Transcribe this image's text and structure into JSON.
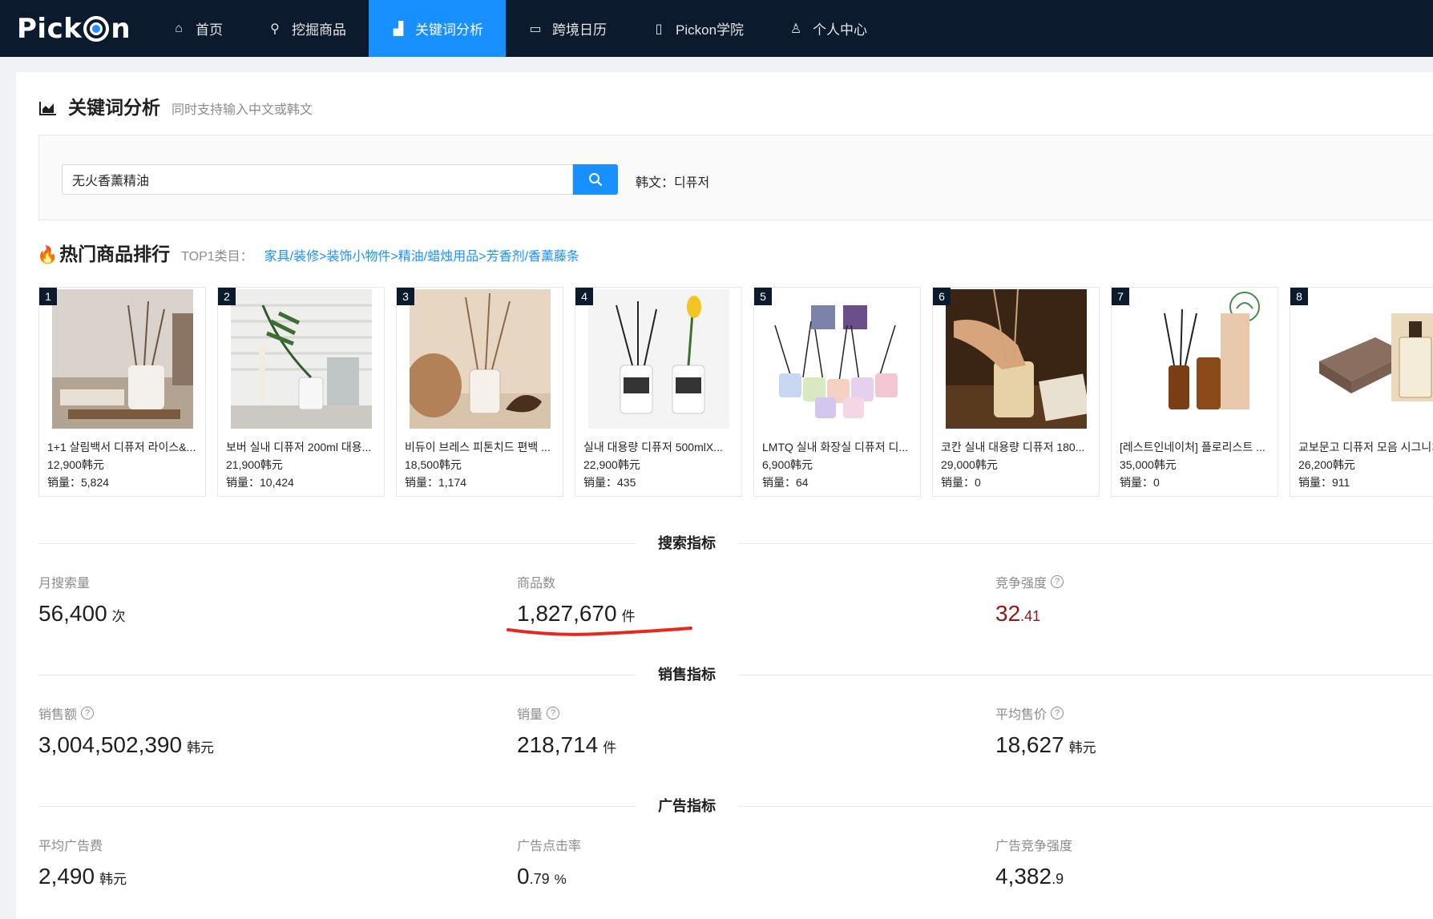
{
  "nav": {
    "logo": "Pick On",
    "items": [
      {
        "label": "首页",
        "icon": "home-icon",
        "glyph": "⌂"
      },
      {
        "label": "挖掘商品",
        "icon": "search-icon",
        "glyph": "⚲"
      },
      {
        "label": "关键词分析",
        "icon": "chart-icon",
        "glyph": "▟",
        "active": true
      },
      {
        "label": "跨境日历",
        "icon": "calendar-icon",
        "glyph": "▭"
      },
      {
        "label": "Pickon学院",
        "icon": "book-icon",
        "glyph": "▯"
      },
      {
        "label": "个人中心",
        "icon": "user-icon",
        "glyph": "♙"
      }
    ]
  },
  "page": {
    "title": "关键词分析",
    "subtitle": "同时支持输入中文或韩文"
  },
  "search": {
    "value": "无火香薰精油",
    "korean_label": "韩文：디퓨저"
  },
  "ranking": {
    "title": "热门商品排行",
    "top1_label": "TOP1类目：",
    "category_path": "家具/装修>装饰小物件>精油/蜡烛用品>芳香剂/香薰藤条",
    "products": [
      {
        "rank": "1",
        "name": "1+1 살림백서 디퓨저 라이스&...",
        "price": "12,900韩元",
        "sales": "销量：5,824"
      },
      {
        "rank": "2",
        "name": "보버 실내 디퓨저 200ml 대용...",
        "price": "21,900韩元",
        "sales": "销量：10,424"
      },
      {
        "rank": "3",
        "name": "비듀이 브레스 피톤치드 편백 ...",
        "price": "18,500韩元",
        "sales": "销量：1,174"
      },
      {
        "rank": "4",
        "name": "실내 대용량 디퓨저 500mlX...",
        "price": "22,900韩元",
        "sales": "销量：435"
      },
      {
        "rank": "5",
        "name": "LMTQ 실내 화장실 디퓨저 디...",
        "price": "6,900韩元",
        "sales": "销量：64"
      },
      {
        "rank": "6",
        "name": "코칸 실내 대용량 디퓨저 180...",
        "price": "29,000韩元",
        "sales": "销量：0"
      },
      {
        "rank": "7",
        "name": "[레스트인네이처] 플로리스트 ...",
        "price": "35,000韩元",
        "sales": "销量：0"
      },
      {
        "rank": "8",
        "name": "교보문고 디퓨저 모음 시그니처",
        "price": "26,200韩元",
        "sales": "销量：911"
      }
    ]
  },
  "sections": {
    "search": "搜索指标",
    "sales": "销售指标",
    "ads": "广告指标"
  },
  "metrics": {
    "monthly_search": {
      "label": "月搜索量",
      "value": "56,400",
      "unit": "次"
    },
    "product_count": {
      "label": "商品数",
      "value": "1,827,670",
      "unit": "件"
    },
    "competition": {
      "label": "竞争强度",
      "int": "32",
      "dec": ".41"
    },
    "sales_amount": {
      "label": "销售额",
      "value": "3,004,502,390",
      "unit": "韩元"
    },
    "sales_volume": {
      "label": "销量",
      "value": "218,714",
      "unit": "件"
    },
    "avg_price": {
      "label": "平均售价",
      "value": "18,627",
      "unit": "韩元"
    },
    "avg_ad_cost": {
      "label": "平均广告费",
      "value": "2,490",
      "unit": "韩元"
    },
    "ad_ctr": {
      "label": "广告点击率",
      "int": "0",
      "dec": ".79",
      "unit": "%"
    },
    "ad_competition": {
      "label": "广告竞争强度",
      "int": "4,382",
      "dec": ".9"
    }
  }
}
